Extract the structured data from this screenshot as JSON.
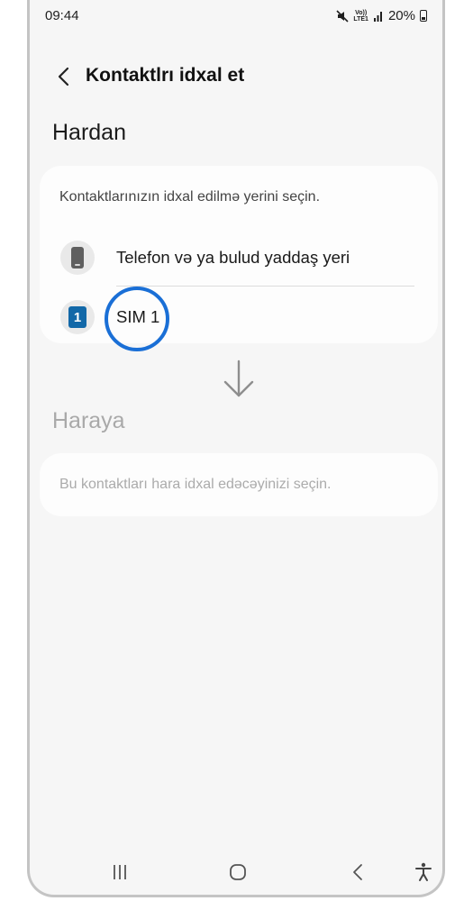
{
  "status_bar": {
    "time": "09:44",
    "network_top": "Vo))",
    "network_bottom": "LTE1",
    "battery": "20%"
  },
  "header": {
    "back_icon": "chevron-left-icon",
    "title": "Kontaktlrı idxal et"
  },
  "from_section": {
    "title": "Hardan",
    "hint": "Kontaktlarınızın idxal edilmə yerini seçin.",
    "items": [
      {
        "icon": "phone-icon",
        "label": "Telefon və ya bulud yaddaş yeri"
      },
      {
        "icon": "sim-card-icon",
        "badge": "1",
        "label": "SIM 1"
      }
    ]
  },
  "to_section": {
    "title": "Haraya",
    "hint": "Bu kontaktları hara idxal edəcəyinizi seçin."
  },
  "colors": {
    "accent_highlight": "#1a6fd6",
    "sim_icon": "#1268a8",
    "background": "#f6f6f6",
    "card": "#fdfdfd"
  }
}
